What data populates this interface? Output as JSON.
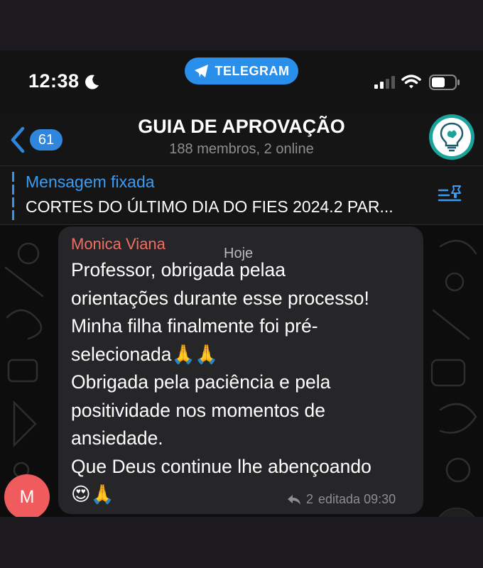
{
  "status_bar": {
    "time": "12:38",
    "app_pill": "TELEGRAM"
  },
  "header": {
    "back_count": "61",
    "title": "GUIA DE APROVAÇÃO",
    "subtitle": "188 membros, 2 online"
  },
  "pinned": {
    "label": "Mensagem fixada",
    "text": "CORTES DO ÚLTIMO DIA DO FIES 2024.2 PAR..."
  },
  "chat": {
    "date_chip": "Hoje",
    "message": {
      "sender": "Monica Viana",
      "sender_initial": "M",
      "lines": [
        "Professor, obrigada pelaa",
        "orientações durante esse processo!",
        "Minha filha finalmente foi pré-",
        "selecionada🙏🙏",
        "Obrigada pela paciência e pela",
        "positividade nos momentos de",
        "ansiedade.",
        "Que Deus continue lhe abençoando",
        "😍🙏"
      ],
      "replies": "2",
      "edited_time": "editada 09:30"
    }
  },
  "colors": {
    "accent": "#2f86dc",
    "sender_name": "#ef6f64",
    "avatar_group": "#1aa39a",
    "avatar_sender": "#f05b5e"
  }
}
